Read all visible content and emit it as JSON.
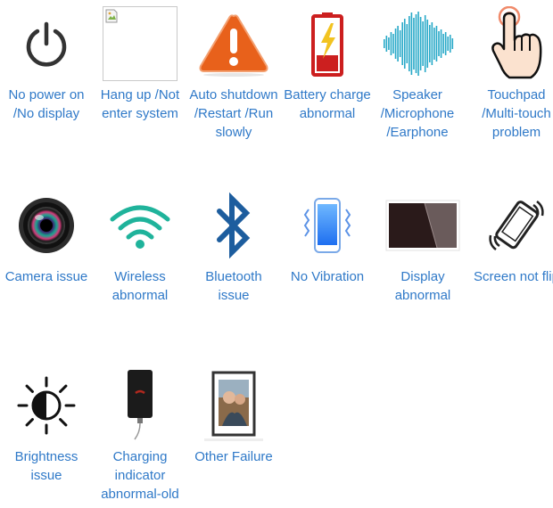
{
  "items": [
    {
      "label": "No power on /No display",
      "icon": "power-icon"
    },
    {
      "label": "Hang up /Not enter system",
      "icon": "broken-image-icon"
    },
    {
      "label": "Auto shutdown /Restart /Run slowly",
      "icon": "warning-icon"
    },
    {
      "label": "Battery charge abnormal",
      "icon": "battery-icon"
    },
    {
      "label": "Speaker /Microphone /Earphone",
      "icon": "sound-wave-icon"
    },
    {
      "label": "Touchpad /Multi-touch problem",
      "icon": "touch-hand-icon"
    },
    {
      "label": "Camera issue",
      "icon": "camera-lens-icon"
    },
    {
      "label": "Wireless abnormal",
      "icon": "wifi-icon"
    },
    {
      "label": "Bluetooth issue",
      "icon": "bluetooth-icon"
    },
    {
      "label": "No Vibration",
      "icon": "vibrating-phone-icon"
    },
    {
      "label": "Display abnormal",
      "icon": "display-panel-icon"
    },
    {
      "label": "Screen not flip",
      "icon": "rotating-phone-icon"
    },
    {
      "label": "Brightness issue",
      "icon": "brightness-icon"
    },
    {
      "label": "Charging indicator abnormal-old",
      "icon": "charging-phone-icon"
    },
    {
      "label": "Other Failure",
      "icon": "photo-frame-icon"
    }
  ],
  "colors": {
    "label": "#2f79c8",
    "power": "#333333",
    "warning": "#e8611b",
    "battery": "#cc1f1f",
    "bolt": "#f2c320",
    "wave": "#28a9c8",
    "wifi": "#1fb39b",
    "bluetooth": "#1d5d9e",
    "vibration": "#3b82f6"
  }
}
